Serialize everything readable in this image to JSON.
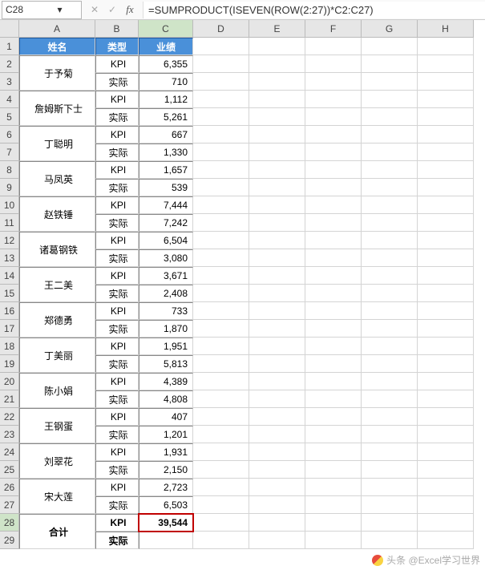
{
  "formulaBar": {
    "nameBox": "C28",
    "cancel": "✕",
    "confirm": "✓",
    "fx": "fx",
    "formula": "=SUMPRODUCT(ISEVEN(ROW(2:27))*C2:C27)"
  },
  "columns": [
    "A",
    "B",
    "C",
    "D",
    "E",
    "F",
    "G",
    "H"
  ],
  "rowStart": 1,
  "rowEnd": 29,
  "headers": {
    "A": "姓名",
    "B": "类型",
    "C": "业绩"
  },
  "labels": {
    "kpi": "KPI",
    "actual": "实际",
    "total": "合计"
  },
  "people": [
    {
      "name": "于予菊",
      "kpi": "6,355",
      "actual": "710"
    },
    {
      "name": "詹姆斯下士",
      "kpi": "1,112",
      "actual": "5,261"
    },
    {
      "name": "丁聪明",
      "kpi": "667",
      "actual": "1,330"
    },
    {
      "name": "马凤英",
      "kpi": "1,657",
      "actual": "539"
    },
    {
      "name": "赵铁锤",
      "kpi": "7,444",
      "actual": "7,242"
    },
    {
      "name": "诸葛钢铁",
      "kpi": "6,504",
      "actual": "3,080"
    },
    {
      "name": "王二美",
      "kpi": "3,671",
      "actual": "2,408"
    },
    {
      "name": "郑德勇",
      "kpi": "733",
      "actual": "1,870"
    },
    {
      "name": "丁美丽",
      "kpi": "1,951",
      "actual": "5,813"
    },
    {
      "name": "陈小娟",
      "kpi": "4,389",
      "actual": "4,808"
    },
    {
      "name": "王钢蛋",
      "kpi": "407",
      "actual": "1,201"
    },
    {
      "name": "刘翠花",
      "kpi": "1,931",
      "actual": "2,150"
    },
    {
      "name": "宋大莲",
      "kpi": "2,723",
      "actual": "6,503"
    }
  ],
  "totals": {
    "kpi": "39,544",
    "actual": ""
  },
  "selectedCell": "C28",
  "watermark": "头条 @Excel学习世界"
}
